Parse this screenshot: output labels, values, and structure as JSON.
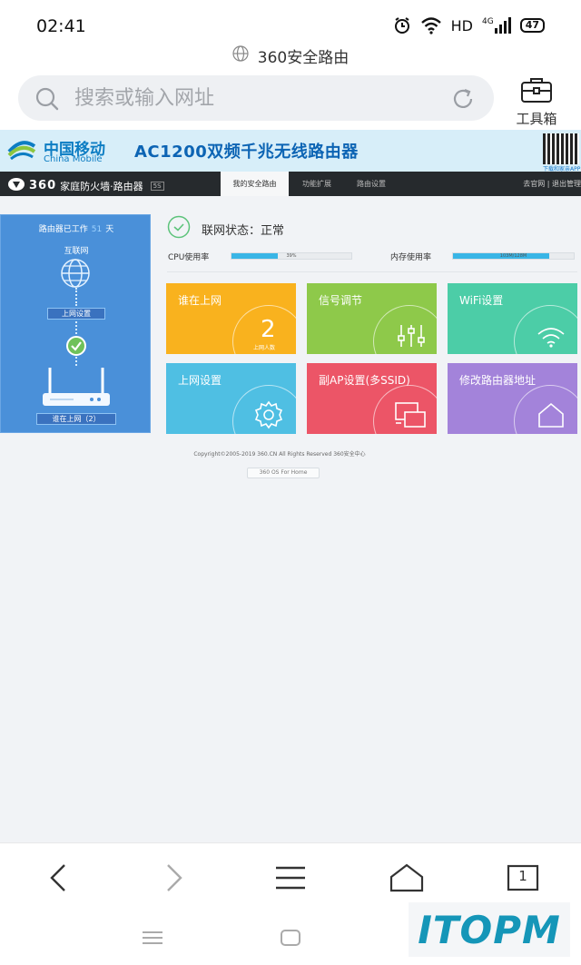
{
  "status_bar": {
    "time": "02:41",
    "network": "HD",
    "signal_type": "4G",
    "battery": "47"
  },
  "browser": {
    "page_title": "360安全路由",
    "search_placeholder": "搜索或输入网址",
    "toolbox_label": "工具箱",
    "tab_count": "1"
  },
  "banner": {
    "brand_cn": "中国移动",
    "brand_en": "China Mobile",
    "product_text": "AC1200双频千兆无线路由器",
    "qr_caption": "下载和家亲APP"
  },
  "router_nav": {
    "brand_num": "360",
    "brand_text": "家庭防火墙·路由器",
    "model": "5S",
    "tabs": [
      {
        "label": "我的安全路由",
        "active": true
      },
      {
        "label": "功能扩展",
        "active": false
      },
      {
        "label": "路由设置",
        "active": false
      }
    ],
    "right_links": "去官网 | 退出管理"
  },
  "left_panel": {
    "uptime_prefix": "路由器已工作",
    "uptime_days": "51",
    "uptime_suffix": "天",
    "internet_label": "互联网",
    "network_settings_button": "上网设置",
    "who_online_button": "谁在上网（2）"
  },
  "status": {
    "net_status": "联网状态：正常",
    "cpu_label": "CPU使用率",
    "cpu_value": "39%",
    "cpu_fraction": 0.39,
    "mem_label": "内存使用率",
    "mem_value": "103M/128M",
    "mem_fraction": 0.8
  },
  "tiles": [
    {
      "title": "谁在上网",
      "count": "2",
      "count_label": "上网人数",
      "color": "#f9b21e"
    },
    {
      "title": "信号调节",
      "color": "#8ec94a"
    },
    {
      "title": "WiFi设置",
      "color": "#4ccda7"
    },
    {
      "title": "上网设置",
      "color": "#4fbfe3"
    },
    {
      "title": "副AP设置(多SSID)",
      "color": "#ec5567"
    },
    {
      "title": "修改路由器地址",
      "color": "#a383da"
    }
  ],
  "footer": {
    "copyright": "Copyright©2005-2019 360.CN All Rights Reserved 360安全中心",
    "os_label": "360 OS For Home"
  },
  "watermark": "ITOPM"
}
